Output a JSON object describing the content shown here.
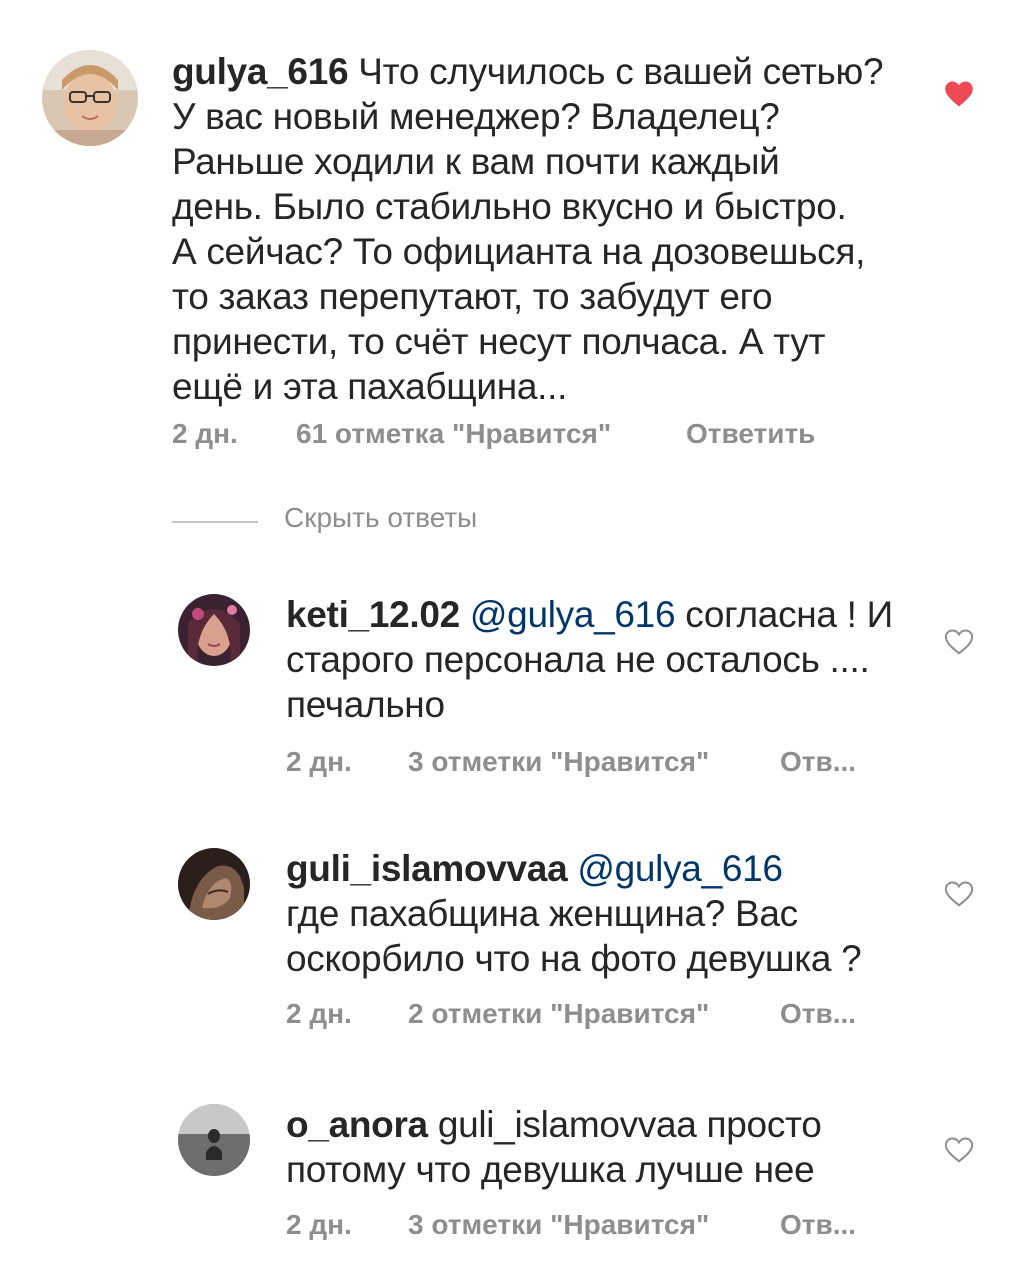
{
  "comments": [
    {
      "username": "gulya_616",
      "mention": "",
      "text": " Что случилось с вашей сетью?\nУ вас новый менеджер? Владелец?\nРаньше ходили к вам почти каждый\nдень. Было стабильно вкусно и быстро.\nА сейчас? То официанта на дозовешься,\nто заказ перепутают, то забудут его\nпринести,  то счёт несут полчаса. А тут\nещё и эта пахабщина...",
      "time": "2 дн.",
      "likes": "61 отметка \"Нравится\"",
      "reply": "Ответить",
      "liked": true
    },
    {
      "username": "keti_12.02",
      "mention": " @gulya_616",
      "text": " согласна ! И\nстарого персонала не осталось ....\nпечально",
      "time": "2 дн.",
      "likes": "3 отметки \"Нравится\"",
      "reply": "Отв...",
      "liked": false
    },
    {
      "username": "guli_islamovvaa",
      "mention": " @gulya_616",
      "text": "\nгде пахабщина женщина? Вас\nоскорбило что на фото девушка ?",
      "time": "2 дн.",
      "likes": "2 отметки \"Нравится\"",
      "reply": "Отв...",
      "liked": false
    },
    {
      "username": "o_anora",
      "mention": "",
      "text": " guli_islamovvaa просто\nпотому что девушка лучше нее",
      "time": "2 дн.",
      "likes": "3 отметки \"Нравится\"",
      "reply": "Отв...",
      "liked": false
    }
  ],
  "hide_replies": "Скрыть ответы",
  "icons": {
    "liked_heart": "heart-filled-icon",
    "unliked_heart": "heart-outline-icon"
  },
  "colors": {
    "text": "#262626",
    "meta": "#8e8e8e",
    "mention": "#00376b",
    "heart_liked": "#ed4956"
  }
}
